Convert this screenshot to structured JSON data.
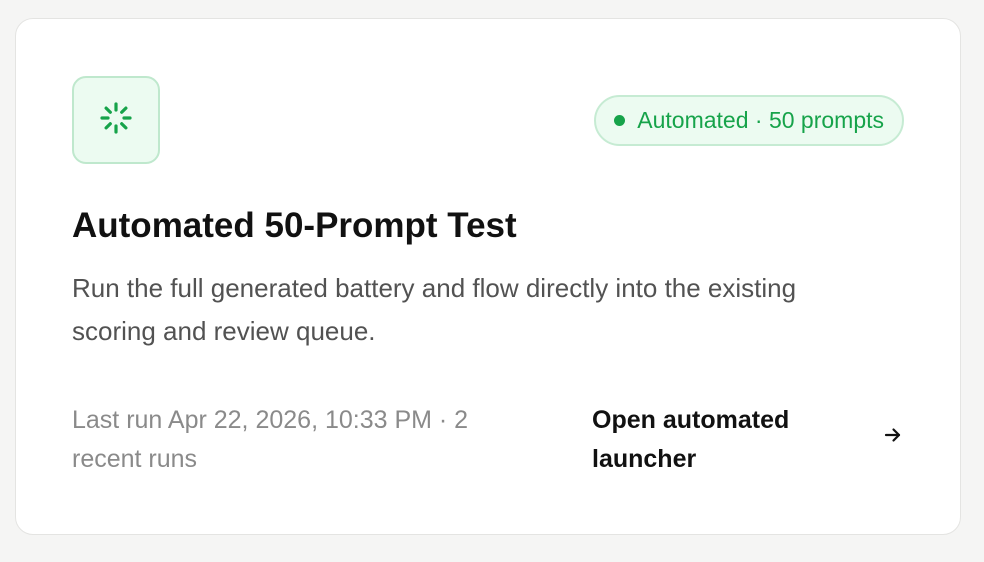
{
  "card": {
    "icon": "loading-spinner-icon",
    "badge": {
      "label": "Automated · 50 prompts",
      "dot_color": "#16a34a"
    },
    "title": "Automated 50-Prompt Test",
    "description": "Run the full generated battery and flow directly into the existing scoring and review queue.",
    "meta": "Last run Apr 22, 2026, 10:33 PM · 2 recent runs",
    "action": {
      "label": "Open automated launcher",
      "icon": "arrow-right-icon"
    }
  },
  "colors": {
    "accent": "#16a34a",
    "accent_bg": "#ecfbf1",
    "title": "#111111",
    "body": "#525252",
    "muted": "#8a8a8a"
  }
}
